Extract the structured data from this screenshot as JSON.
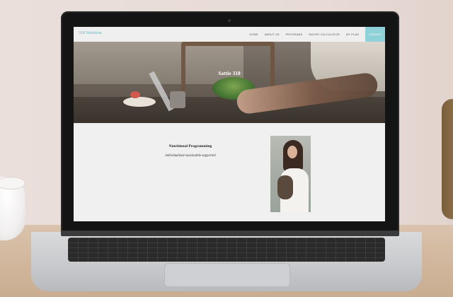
{
  "site": {
    "brand": "318 Nutrition",
    "nav": {
      "home": "HOME",
      "about": "ABOUT US",
      "programs": "PROGRAMS",
      "macro": "MACRO CALCULATOR",
      "plan": "MY PLAN",
      "contact": "CONTACT"
    },
    "hero": {
      "title": "Sattie 318"
    },
    "program": {
      "title": "Nutritional Programming",
      "subtitle": "individualized-sustainable-supported"
    }
  },
  "colors": {
    "brand": "#5fb9c5",
    "contact_bg": "#8fd1d8"
  }
}
